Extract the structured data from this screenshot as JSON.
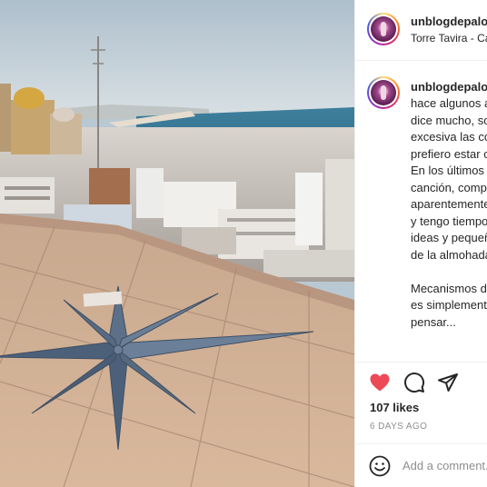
{
  "post": {
    "username": "unblogdepaloma",
    "location": "Torre Tavira - Cádiz",
    "caption": "hace algunos años me leí non dice mucho, soy habladora excesiva las cosas importantes prefiero estar callada y que noten. En los últimos tiempos otra canción, compartir esta aparentemente vacía; años estoy y tengo tiempo a perfeccionar... ideas y pequeñas cosas debajo de la almohada y revelen.\n\nMecanismos de defensa realidad es simplemente ridículo de pensar..."
  },
  "actions": {
    "likes": "107 likes",
    "date": "6 DAYS AGO"
  },
  "comment": {
    "placeholder": "Add a comment..."
  },
  "icons": {
    "like": "heart-icon",
    "comment": "comment-icon",
    "share": "paper-plane-icon",
    "emoji": "emoji-icon"
  },
  "colors": {
    "like_red": "#ed4956",
    "text": "#262626",
    "muted": "#8e8e8e",
    "divider": "#efefef"
  }
}
